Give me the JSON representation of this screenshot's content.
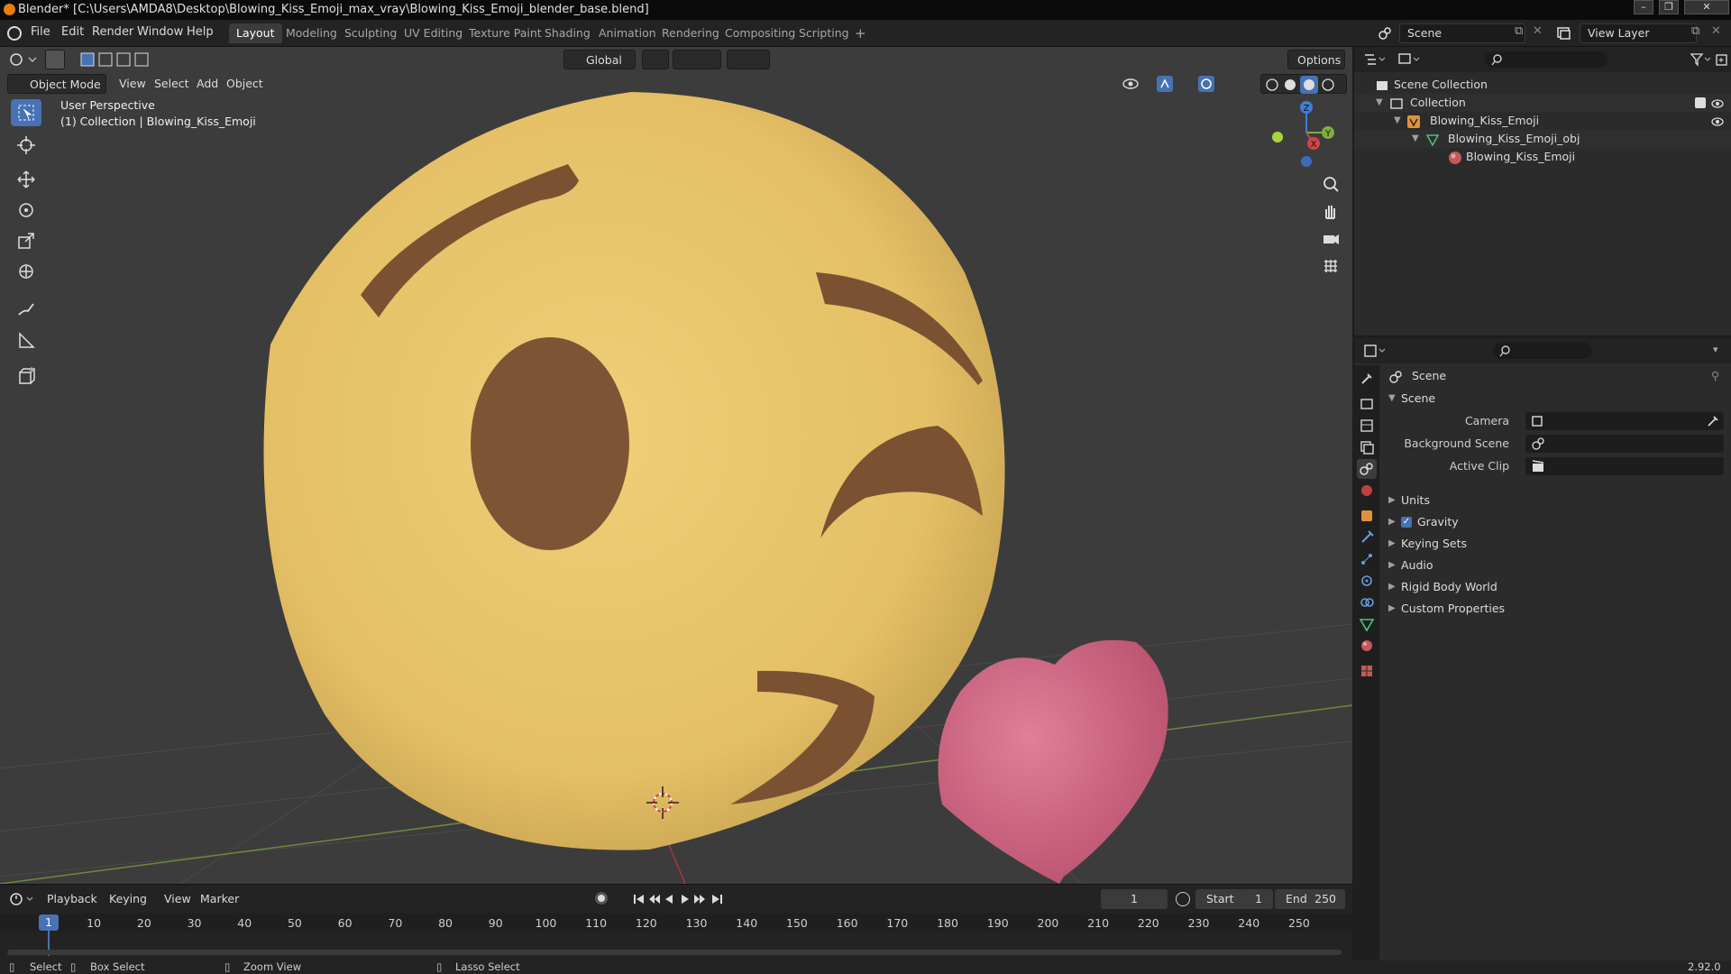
{
  "window": {
    "title": "Blender* [C:\\Users\\AMDA8\\Desktop\\Blowing_Kiss_Emoji_max_vray\\Blowing_Kiss_Emoji_blender_base.blend]"
  },
  "menu": {
    "file": "File",
    "edit": "Edit",
    "render": "Render",
    "window": "Window",
    "help": "Help"
  },
  "workspaces": [
    "Layout",
    "Modeling",
    "Sculpting",
    "UV Editing",
    "Texture Paint",
    "Shading",
    "Animation",
    "Rendering",
    "Compositing",
    "Scripting"
  ],
  "scene_selector": {
    "value": "Scene"
  },
  "view_layer_selector": {
    "value": "View Layer"
  },
  "viewport": {
    "mode": "Object Mode",
    "menus": {
      "view": "View",
      "select": "Select",
      "add": "Add",
      "object": "Object"
    },
    "transform_orientation": "Global",
    "options_label": "Options",
    "overlay_line1": "User Perspective",
    "overlay_line2": "(1) Collection | Blowing_Kiss_Emoji",
    "gizmo": {
      "x": "X",
      "y": "Y",
      "z": "Z"
    }
  },
  "outliner": {
    "root": "Scene Collection",
    "collection": "Collection",
    "object": "Blowing_Kiss_Emoji",
    "mesh": "Blowing_Kiss_Emoji_obj",
    "material": "Blowing_Kiss_Emoji"
  },
  "properties": {
    "context": "Scene",
    "panel": "Scene",
    "camera_label": "Camera",
    "background_scene_label": "Background Scene",
    "active_clip_label": "Active Clip",
    "subpanels": [
      "Units",
      "Gravity",
      "Keying Sets",
      "Audio",
      "Rigid Body World",
      "Custom Properties"
    ],
    "gravity_enabled": true
  },
  "timeline": {
    "playback": "Playback",
    "keying": "Keying",
    "view": "View",
    "marker": "Marker",
    "current_frame": "1",
    "start_label": "Start",
    "start_value": "1",
    "end_label": "End",
    "end_value": "250",
    "ticks": [
      "10",
      "20",
      "30",
      "40",
      "50",
      "60",
      "70",
      "80",
      "90",
      "100",
      "110",
      "120",
      "130",
      "140",
      "150",
      "160",
      "170",
      "180",
      "190",
      "200",
      "210",
      "220",
      "230",
      "240",
      "250"
    ],
    "playhead": "1"
  },
  "status": {
    "select": "Select",
    "box_select": "Box Select",
    "zoom_view": "Zoom View",
    "lasso_select": "Lasso Select",
    "version": "2.92.0"
  },
  "colors": {
    "accent": "#4772b3",
    "emoji_face": "#e8c46a",
    "emoji_features": "#7a5232",
    "heart": "#d36a87"
  }
}
